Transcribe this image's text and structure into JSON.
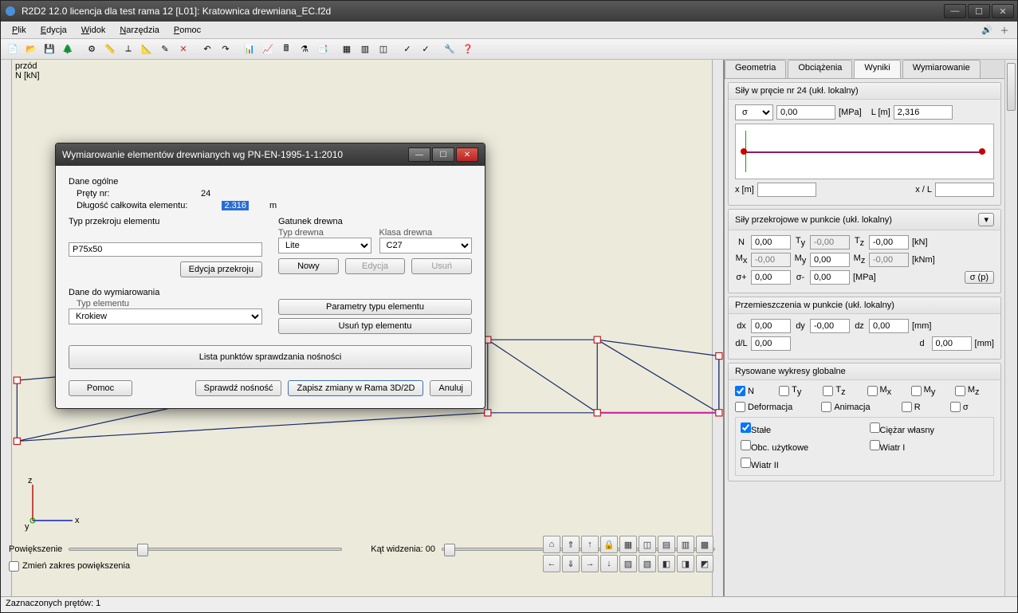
{
  "window": {
    "title": "R2D2 12.0 licencja dla test rama 12 [L01]: Kratownica drewniana_EC.f2d"
  },
  "menu": {
    "plik": "Plik",
    "edycja": "Edycja",
    "widok": "Widok",
    "narzedzia": "Narzędzia",
    "pomoc": "Pomoc"
  },
  "canvas": {
    "view_label": "przód",
    "quantity_label": "N [kN]",
    "zoom_label": "Powiększenie",
    "angle_label": "Kąt widzenia: 00",
    "zoom_check": "Zmień zakres powiększenia"
  },
  "status": {
    "text": "Zaznaczonych prętów: 1"
  },
  "tabs": {
    "geometria": "Geometria",
    "obciazenia": "Obciążenia",
    "wyniki": "Wyniki",
    "wymiarowanie": "Wymiarowanie"
  },
  "forces_header": "Siły w pręcie nr 24 (ukł. lokalny)",
  "sigma_dropdown": "σ",
  "sigma_val": "0,00",
  "sigma_unit": "[MPa]",
  "L_label": "L [m]",
  "L_val": "2,316",
  "x_label": "x [m]",
  "xL_label": "x / L",
  "section_header": "Siły przekrojowe w punkcie (ukł. lokalny)",
  "forces": {
    "N": "0,00",
    "Ty": "-0,00",
    "Tz": "-0,00",
    "kN": "[kN]",
    "Mx": "-0,00",
    "My": "0,00",
    "Mz": "-0,00",
    "kNm": "[kNm]",
    "sp": "0,00",
    "sm": "0,00",
    "MPa": "[MPa]",
    "sigma_btn": "σ (p)"
  },
  "disp_header": "Przemieszczenia w punkcie (ukł. lokalny)",
  "disp": {
    "dx": "0,00",
    "dy": "-0,00",
    "dz": "0,00",
    "mm": "[mm]",
    "dL": "0,00",
    "d": "0,00"
  },
  "charts_header": "Rysowane wykresy globalne",
  "charts": {
    "N": "N",
    "Ty": "T",
    "Tz": "T",
    "Mx": "M",
    "My": "M",
    "Mz": "M",
    "def": "Deformacja",
    "anim": "Animacja",
    "R": "R",
    "sigma": "σ",
    "stale": "Stałe",
    "ciezar": "Ciężar własny",
    "obc": "Obc. użytkowe",
    "wiatr1": "Wiatr I",
    "wiatr2": "Wiatr II"
  },
  "dialog": {
    "title": "Wymiarowanie elementów drewnianych wg PN-EN-1995-1-1:2010",
    "dane_ogolne": "Dane ogólne",
    "prety_nr": "Pręty nr:",
    "prety_val": "24",
    "dlugosc": "Długość całkowita elementu:",
    "dlugosc_val": "2.316",
    "dlugosc_unit": "m",
    "typ_przekroju": "Typ przekroju elementu",
    "przekroj_val": "P75x50",
    "edycja_przekroju": "Edycja przekroju",
    "gatunek": "Gatunek drewna",
    "typ_drewna": "Typ drewna",
    "typ_drewna_val": "Lite",
    "klasa": "Klasa drewna",
    "klasa_val": "C27",
    "nowy": "Nowy",
    "edycja": "Edycja",
    "usun": "Usuń",
    "dane_wym": "Dane do wymiarowania",
    "typ_elem": "Typ elementu",
    "typ_elem_val": "Krokiew",
    "param": "Parametry typu elementu",
    "usun_typ": "Usuń typ elementu",
    "lista": "Lista punktów sprawdzania nośności",
    "pomoc": "Pomoc",
    "sprawdz": "Sprawdź nośność",
    "zapisz": "Zapisz zmiany w Rama 3D/2D",
    "anuluj": "Anuluj"
  }
}
